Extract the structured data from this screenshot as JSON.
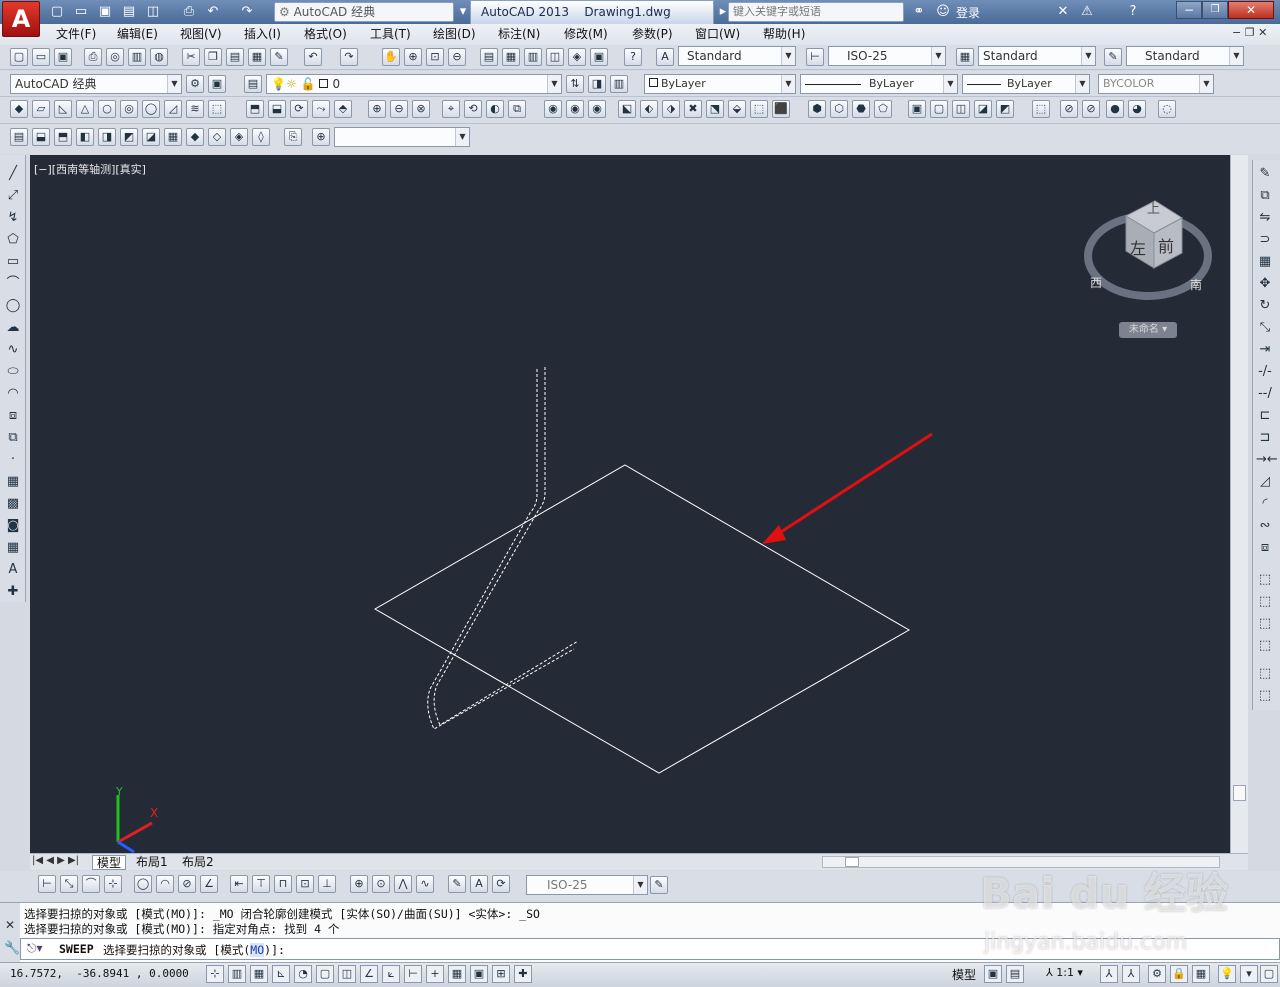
{
  "app": {
    "logo": "A",
    "workspace": "AutoCAD 经典",
    "product": "AutoCAD 2013",
    "document": "Drawing1.dwg",
    "search_placeholder": "键入关键字或短语",
    "login": "登录"
  },
  "menu": [
    "文件(F)",
    "编辑(E)",
    "视图(V)",
    "插入(I)",
    "格式(O)",
    "工具(T)",
    "绘图(D)",
    "标注(N)",
    "修改(M)",
    "参数(P)",
    "窗口(W)",
    "帮助(H)"
  ],
  "styles": {
    "text_style": "Standard",
    "dim_style": "ISO-25",
    "table_style": "Standard",
    "mleader_style": "Standard"
  },
  "layers": {
    "workspace": "AutoCAD 经典",
    "current_layer": "0",
    "color": "ByLayer",
    "linetype": "ByLayer",
    "lineweight": "ByLayer",
    "plotstyle": "BYCOLOR"
  },
  "viewport": {
    "label": "[−][西南等轴测][真实]",
    "viewcube": {
      "top": "上",
      "left": "左",
      "front": "前",
      "west": "西",
      "south": "南",
      "wcs": "未命名"
    }
  },
  "layout_tabs": [
    "模型",
    "布局1",
    "布局2"
  ],
  "dim_combo": "ISO-25",
  "command_history": [
    "选择要扫掠的对象或 [模式(MO)]: _MO 闭合轮廓创建模式 [实体(SO)/曲面(SU)] <实体>: _SO",
    "选择要扫掠的对象或 [模式(MO)]: 指定对角点: 找到 4 个"
  ],
  "command_prompt": {
    "cmd": "SWEEP",
    "text": "选择要扫掠的对象或 [模式(",
    "opt": "MO",
    "end": ")]:"
  },
  "status": {
    "coords": "16.7572,  -36.8941 , 0.0000",
    "model": "模型",
    "scale": "1:1"
  },
  "watermark": {
    "logo": "Bai du 经验",
    "url": "jingyan.baidu.com"
  },
  "colors": {
    "viewport_bg": "#252b36",
    "arrow": "#e01010",
    "geometry": "#ffffff"
  }
}
